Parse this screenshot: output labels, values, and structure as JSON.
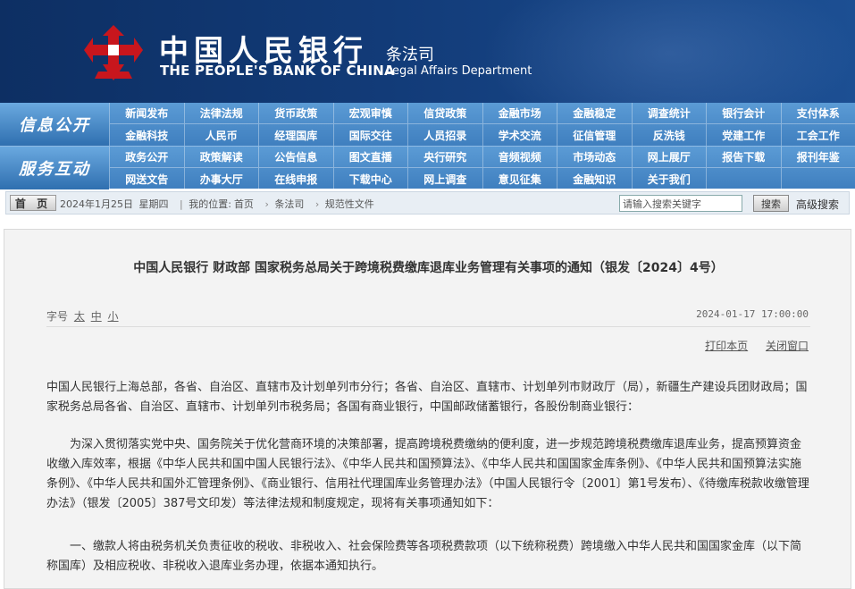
{
  "header": {
    "bank_name_cn": "中国人民银行",
    "bank_name_en": "THE PEOPLE'S BANK OF CHINA",
    "dept_cn": "条法司",
    "dept_en": "Legal Affairs Department",
    "logo_icon": "pboc-logo-icon",
    "brand_color": "#c8161d"
  },
  "nav": {
    "row1_head": "信息公开",
    "row1_items": [
      "新闻发布",
      "法律法规",
      "货币政策",
      "宏观审慎",
      "信贷政策",
      "金融市场",
      "金融稳定",
      "调查统计",
      "银行会计",
      "支付体系",
      "金融科技",
      "人民币",
      "经理国库",
      "国际交往",
      "人员招录",
      "学术交流",
      "征信管理",
      "反洗钱",
      "党建工作",
      "工会工作"
    ],
    "row2_head": "服务互动",
    "row2_items": [
      "政务公开",
      "政策解读",
      "公告信息",
      "图文直播",
      "央行研究",
      "音频视频",
      "市场动态",
      "网上展厅",
      "报告下载",
      "报刊年鉴",
      "网送文告",
      "办事大厅",
      "在线申报",
      "下载中心",
      "网上调查",
      "意见征集",
      "金融知识",
      "关于我们",
      "",
      ""
    ]
  },
  "breadcrumb": {
    "home_label": "首 页",
    "date": "2024年1月25日",
    "weekday": "星期四",
    "location_label": "我的位置:",
    "path": [
      "首页",
      "条法司",
      "规范性文件"
    ],
    "search_placeholder": "请输入搜索关键字",
    "search_button": "搜索",
    "advanced_search": "高级搜索"
  },
  "article": {
    "title": "中国人民银行  财政部  国家税务总局关于跨境税费缴库退库业务管理有关事项的通知（银发〔2024〕4号）",
    "font_label": "字号",
    "font_sizes": [
      "太",
      "中",
      "小"
    ],
    "published": "2024-01-17 17:00:00",
    "print_label": "打印本页",
    "close_label": "关闭窗口",
    "paragraphs": [
      "中国人民银行上海总部，各省、自治区、直辖市及计划单列市分行；各省、自治区、直辖市、计划单列市财政厅（局），新疆生产建设兵团财政局；国家税务总局各省、自治区、直辖市、计划单列市税务局；各国有商业银行，中国邮政储蓄银行，各股份制商业银行：",
      "为深入贯彻落实党中央、国务院关于优化营商环境的决策部署，提高跨境税费缴纳的便利度，进一步规范跨境税费缴库退库业务，提高预算资金收缴入库效率，根据《中华人民共和国中国人民银行法》、《中华人民共和国预算法》、《中华人民共和国国家金库条例》、《中华人民共和国预算法实施条例》、《中华人民共和国外汇管理条例》、《商业银行、信用社代理国库业务管理办法》（中国人民银行令〔2001〕第1号发布）、《待缴库税款收缴管理办法》（银发〔2005〕387号文印发）等法律法规和制度规定，现将有关事项通知如下：",
      "一、缴款人将由税务机关负责征收的税收、非税收入、社会保险费等各项税费款项（以下统称税费）跨境缴入中华人民共和国国家金库（以下简称国库）及相应税收、非税收入退库业务办理，依据本通知执行。"
    ]
  }
}
